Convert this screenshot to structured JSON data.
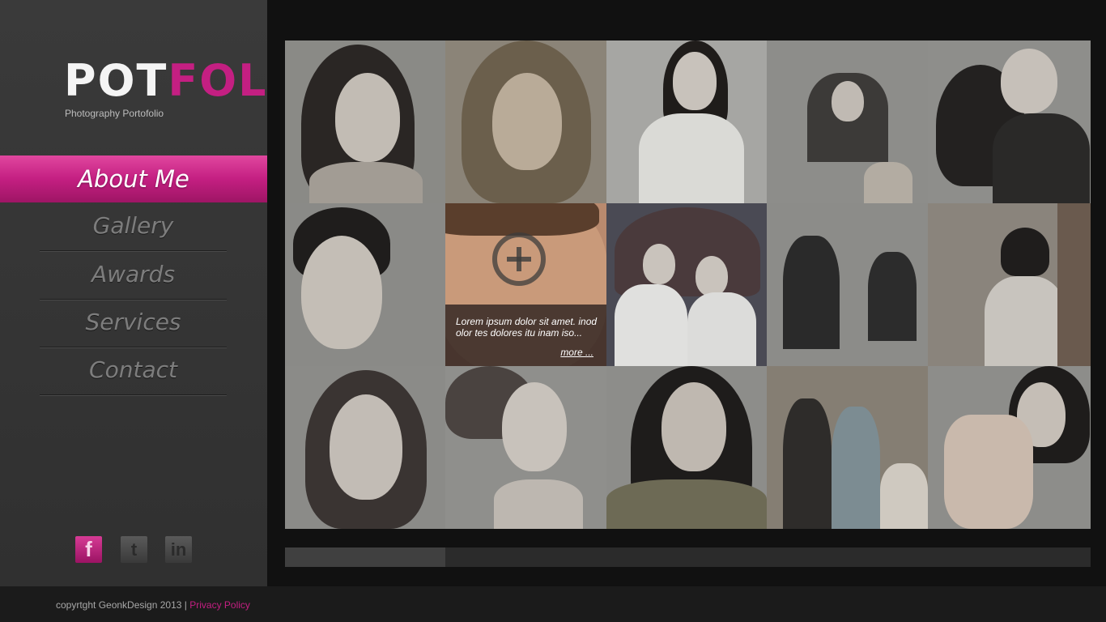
{
  "brand": {
    "logo_part1": "POT",
    "logo_part2": "FOL",
    "tagline": "Photography Portofolio",
    "accent_color": "#c41f82"
  },
  "nav": {
    "active": "About Me",
    "items": [
      "Gallery",
      "Awards",
      "Services",
      "Contact"
    ]
  },
  "social": {
    "facebook": "f",
    "twitter": "t",
    "linkedin": "in"
  },
  "gallery": {
    "rows": 3,
    "columns": 5,
    "hover_caption": "Lorem ipsum dolor sit amet. inod olor tes dolores itu inam iso...",
    "hover_more": "more ..."
  },
  "footer": {
    "copyright": "copyrtght GeonkDesign 2013",
    "separator": "|",
    "privacy": "Privacy Policy"
  }
}
